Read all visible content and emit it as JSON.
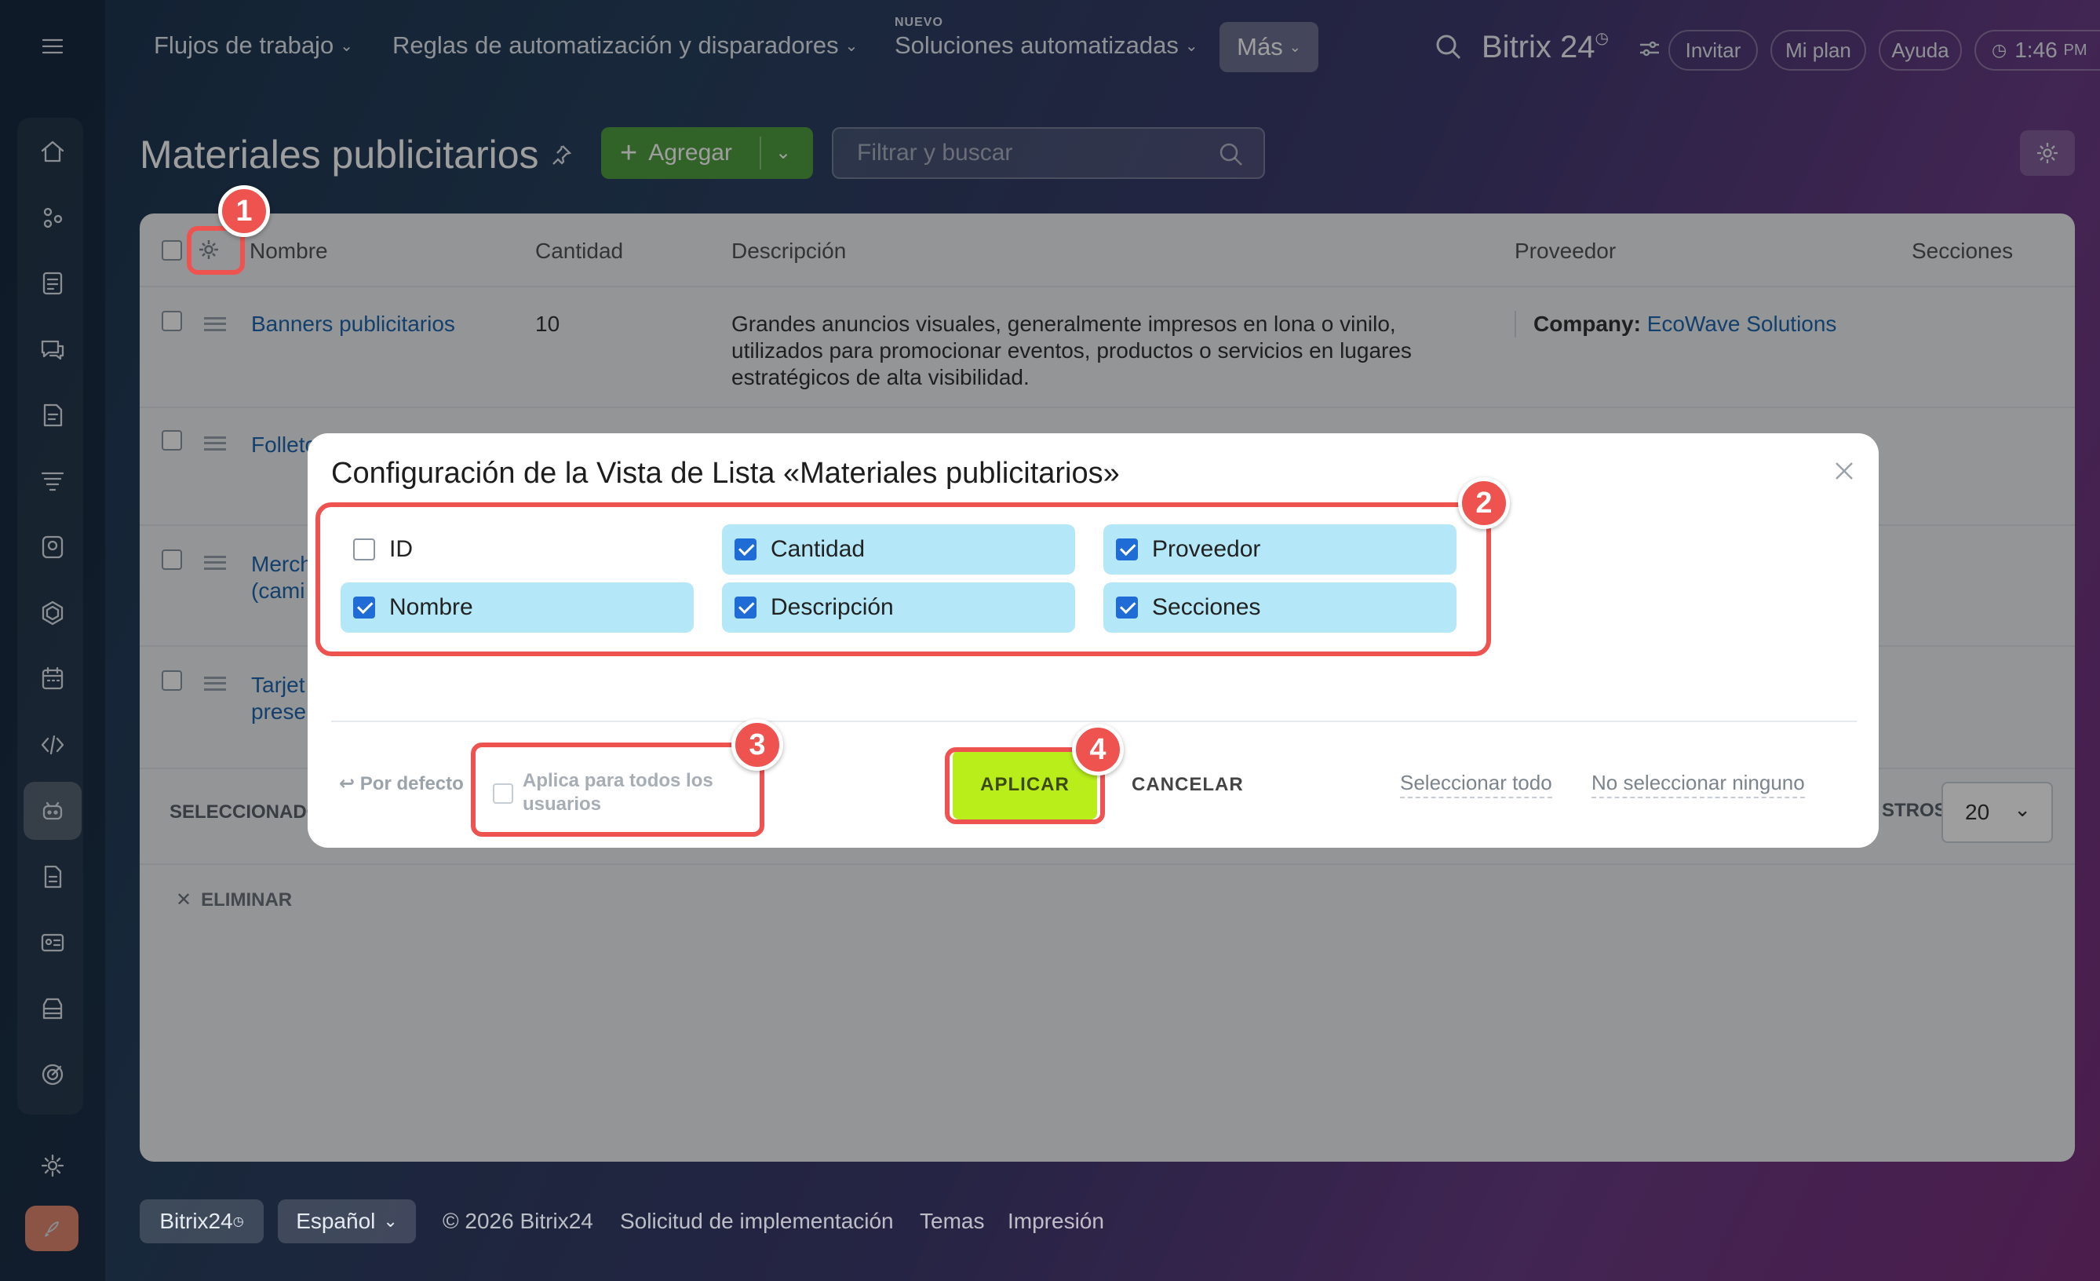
{
  "topbar": {
    "menu_items": [
      "Flujos de trabajo",
      "Reglas de automatización y disparadores",
      "Soluciones automatizadas"
    ],
    "new_badge": "NUEVO",
    "more_label": "Más",
    "brand": "Bitrix 24",
    "invite": "Invitar",
    "my_plan": "Mi plan",
    "help": "Ayuda",
    "time": "1:46",
    "ampm": "PM"
  },
  "page": {
    "title": "Materiales publicitarios",
    "add_button": "Agregar",
    "filter_placeholder": "Filtrar y buscar"
  },
  "table": {
    "columns": [
      "Nombre",
      "Cantidad",
      "Descripción",
      "Proveedor",
      "Secciones"
    ],
    "rows": [
      {
        "name": "Banners publicitarios",
        "qty": "10",
        "desc_lines": [
          "Grandes anuncios visuales, generalmente impresos en lona o vinilo,",
          "utilizados para promocionar eventos, productos o servicios en lugares",
          "estratégicos de alta visibilidad."
        ],
        "supplier_label": "Company:",
        "supplier": "EcoWave Solutions"
      },
      {
        "name_lines": [
          "Folleto"
        ]
      },
      {
        "name_lines": [
          "Merch",
          "(cami"
        ]
      },
      {
        "name_lines": [
          "Tarjet",
          "prese"
        ]
      }
    ],
    "selected_label": "SELECCIONADO",
    "delete_label": "ELIMINAR",
    "records_label": "STROS:",
    "records_value": "20"
  },
  "dialog": {
    "title": "Configuración de la Vista de Lista «Materiales publicitarios»",
    "options": [
      {
        "label": "ID",
        "checked": false
      },
      {
        "label": "Cantidad",
        "checked": true
      },
      {
        "label": "Proveedor",
        "checked": true
      },
      {
        "label": "Nombre",
        "checked": true
      },
      {
        "label": "Descripción",
        "checked": true
      },
      {
        "label": "Secciones",
        "checked": true
      }
    ],
    "default_label": "Por defecto",
    "apply_all_lines": [
      "Aplica para todos los",
      "usuarios"
    ],
    "apply_button": "APLICAR",
    "cancel_button": "CANCELAR",
    "select_all": "Seleccionar todo",
    "select_none": "No seleccionar ninguno"
  },
  "callouts": [
    "1",
    "2",
    "3",
    "4"
  ],
  "footer": {
    "brand": "Bitrix24",
    "language": "Español",
    "copyright": "© 2026 Bitrix24",
    "links": [
      "Solicitud de implementación",
      "Temas",
      "Impresión"
    ]
  },
  "colors": {
    "accent_green": "#4f9f3f",
    "apply_green": "#b9ee1b",
    "callout_red": "#ef5350",
    "checked_bg": "#b4e8f8",
    "checkbox_blue": "#1f6cd6",
    "link_blue": "#2066b0"
  }
}
